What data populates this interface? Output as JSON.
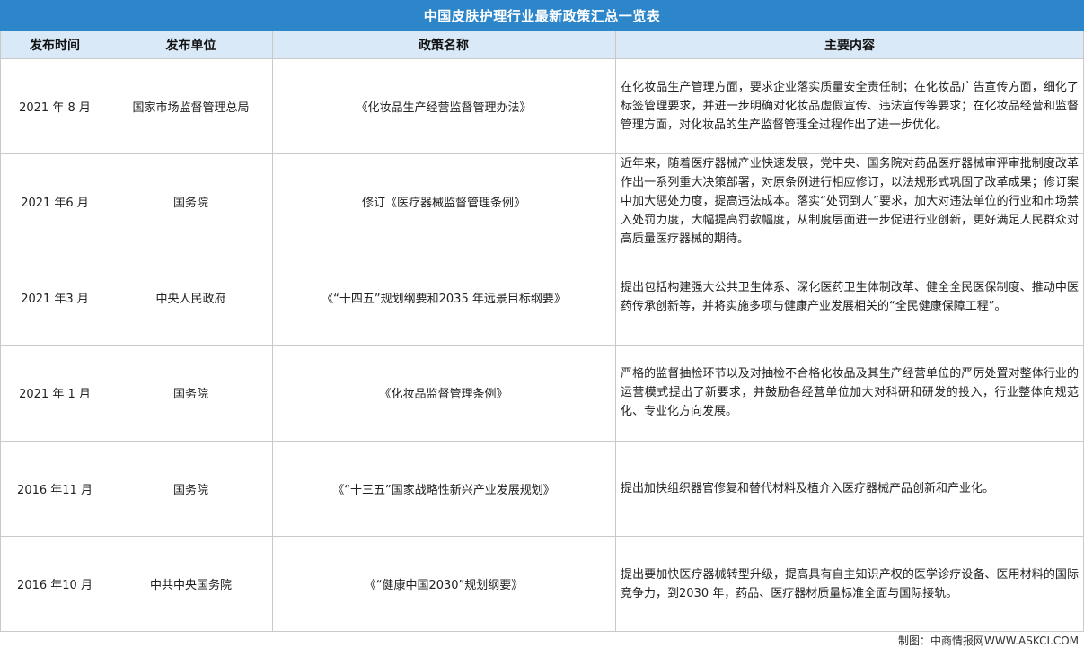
{
  "title": "中国皮肤护理行业最新政策汇总一览表",
  "columns": [
    "发布时间",
    "发布单位",
    "政策名称",
    "主要内容"
  ],
  "rows": [
    {
      "date": "2021 年 8 月",
      "issuer": "国家市场监督管理总局",
      "policy": "《化妆品生产经营监督管理办法》",
      "content": "在化妆品生产管理方面，要求企业落实质量安全责任制；在化妆品广告宣传方面，细化了标签管理要求，并进一步明确对化妆品虚假宣传、违法宣传等要求；在化妆品经营和监督管理方面，对化妆品的生产监督管理全过程作出了进一步优化。"
    },
    {
      "date": "2021 年6 月",
      "issuer": "国务院",
      "policy": "修订《医疗器械监督管理条例》",
      "content": "近年来，随着医疗器械产业快速发展，党中央、国务院对药品医疗器械审评审批制度改革作出一系列重大决策部署，对原条例进行相应修订，以法规形式巩固了改革成果；修订案中加大惩处力度，提高违法成本。落实“处罚到人”要求，加大对违法单位的行业和市场禁入处罚力度，大幅提高罚款幅度，从制度层面进一步促进行业创新，更好满足人民群众对高质量医疗器械的期待。"
    },
    {
      "date": "2021 年3 月",
      "issuer": "中央人民政府",
      "policy": "《“十四五”规划纲要和2035 年远景目标纲要》",
      "content": "提出包括构建强大公共卫生体系、深化医药卫生体制改革、健全全民医保制度、推动中医药传承创新等，并将实施多项与健康产业发展相关的“全民健康保障工程”。"
    },
    {
      "date": "2021 年 1 月",
      "issuer": "国务院",
      "policy": "《化妆品监督管理条例》",
      "content": "严格的监督抽检环节以及对抽检不合格化妆品及其生产经营单位的严厉处置对整体行业的运营模式提出了新要求，并鼓励各经营单位加大对科研和研发的投入，行业整体向规范化、专业化方向发展。"
    },
    {
      "date": "2016 年11 月",
      "issuer": "国务院",
      "policy": "《“十三五”国家战略性新兴产业发展规划》",
      "content": "提出加快组织器官修复和替代材料及植介入医疗器械产品创新和产业化。"
    },
    {
      "date": "2016 年10 月",
      "issuer": "中共中央国务院",
      "policy": "《“健康中国2030”规划纲要》",
      "content": "提出要加快医疗器械转型升级，提高具有自主知识产权的医学诊疗设备、医用材料的国际竞争力，到2030 年，药品、医疗器材质量标准全面与国际接轨。"
    }
  ],
  "footer": "制图：中商情报网WWW.ASKCI.COM",
  "colors": {
    "title_bg": "#2D86C9",
    "header_bg": "#D9E9F7",
    "grid": "#C9C9C9"
  }
}
